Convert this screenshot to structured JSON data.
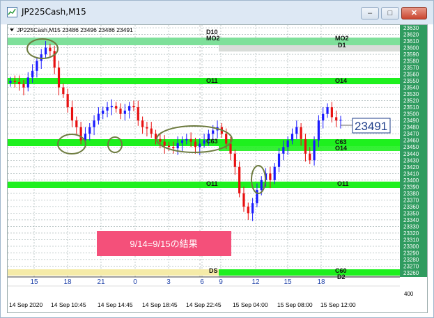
{
  "window": {
    "title": "JP225Cash,M15",
    "min_label": "–",
    "max_label": "□",
    "close_label": "✕",
    "icon": "chart-app-icon"
  },
  "chart_header": {
    "symbol_info": "JP225Cash,M15  23486 23496 23486 23491",
    "dropdown_icon": "triangle-down-icon"
  },
  "price_axis": {
    "ticks": [
      "23630",
      "23620",
      "23610",
      "23600",
      "23590",
      "23580",
      "23570",
      "23560",
      "23550",
      "23540",
      "23530",
      "23520",
      "23510",
      "23500",
      "23490",
      "23480",
      "23470",
      "23460",
      "23450",
      "23440",
      "23430",
      "23420",
      "23410",
      "23400",
      "23390",
      "23380",
      "23370",
      "23360",
      "23350",
      "23340",
      "23330",
      "23320",
      "23310",
      "23300",
      "23290",
      "23280",
      "23270",
      "23260"
    ],
    "bottom_label": "400",
    "current_price_label": "23491",
    "accent_color": "#2f9b5f"
  },
  "time_axis": {
    "hour_labels": [
      "15",
      "18",
      "21",
      "0",
      "3",
      "6",
      "9",
      "12",
      "15",
      "18"
    ],
    "datetime_labels": [
      "14 Sep 2020",
      "14 Sep 10:45",
      "14 Sep 14:45",
      "14 Sep 18:45",
      "14 Sep 22:45",
      "15 Sep 04:00",
      "15 Sep 08:00",
      "15 Sep 12:00"
    ]
  },
  "levels": {
    "MO2": "MO2",
    "D10": "D10",
    "D1": "D1",
    "O11_upper_left": "O11",
    "O14_upper_right": "O14",
    "C63": "C63",
    "O14_mid": "O14",
    "O11_lower_left": "O11",
    "O11_lower_right": "O11",
    "DS": "DS",
    "C60": "C60",
    "D2": "D2"
  },
  "annotation": {
    "result_text": "9/14=9/15の結果",
    "bg_color": "#f4507a"
  },
  "colors": {
    "level_green": "#1ef01e",
    "candle_up": "#1a1aff",
    "candle_down": "#e81010",
    "ellipse": "#6e7c40"
  },
  "chart_data": {
    "type": "candlestick",
    "symbol": "JP225Cash",
    "timeframe": "M15",
    "last_price": 23491,
    "header_ohlc": [
      23486,
      23496,
      23486,
      23491
    ],
    "horizontal_levels": [
      {
        "label": "MO2",
        "value": 23612
      },
      {
        "label": "D10",
        "value": 23622
      },
      {
        "label": "D1",
        "value": 23606
      },
      {
        "label": "O11",
        "value": 23553
      },
      {
        "label": "O14",
        "value": 23553
      },
      {
        "label": "C63",
        "value": 23467
      },
      {
        "label": "O14",
        "value": 23462
      },
      {
        "label": "O11",
        "value": 23404
      },
      {
        "label": "DS",
        "value": 23278
      },
      {
        "label": "C60",
        "value": 23276
      },
      {
        "label": "D2",
        "value": 23269
      }
    ],
    "ylim": [
      23255,
      23635
    ],
    "grid": true,
    "closes": [
      23550,
      23548,
      23545,
      23540,
      23555,
      23565,
      23580,
      23590,
      23600,
      23595,
      23570,
      23540,
      23530,
      23510,
      23490,
      23480,
      23460,
      23470,
      23480,
      23490,
      23500,
      23505,
      23510,
      23512,
      23508,
      23500,
      23505,
      23512,
      23510,
      23490,
      23480,
      23478,
      23470,
      23462,
      23458,
      23452,
      23450,
      23448,
      23456,
      23460,
      23462,
      23458,
      23450,
      23455,
      23460,
      23470,
      23475,
      23480,
      23470,
      23455,
      23440,
      23420,
      23380,
      23360,
      23350,
      23365,
      23385,
      23400,
      23410,
      23400,
      23420,
      23440,
      23450,
      23460,
      23470,
      23480,
      23462,
      23440,
      23430,
      23460,
      23490,
      23500,
      23510,
      23495,
      23490,
      23491
    ]
  }
}
